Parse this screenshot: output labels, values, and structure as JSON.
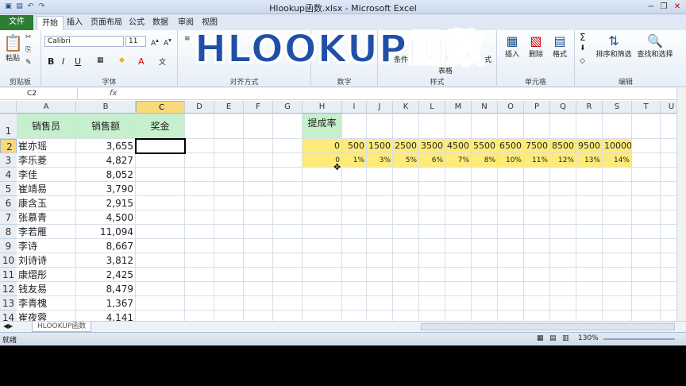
{
  "window": {
    "title": "Hlookup函数.xlsx - Microsoft Excel"
  },
  "overlay_title": "HLOOKUP函数",
  "tabs": [
    "文件",
    "开始",
    "插入",
    "页面布局",
    "公式",
    "数据",
    "审阅",
    "视图"
  ],
  "ribbon": {
    "paste": "粘贴",
    "clipboard": "剪贴板",
    "font_name": "Calibri",
    "font_size": "11",
    "font": "字体",
    "alignment": "对齐方式",
    "number": "数字",
    "style_partial_1": "条件",
    "style_partial_2": "表格",
    "style_partial_3": "式",
    "styles": "样式",
    "insert": "插入",
    "delete": "删除",
    "format": "格式",
    "cells": "单元格",
    "sort_filter": "排序和筛选",
    "find_select": "查找和选择",
    "editing": "编辑"
  },
  "namebox": "C2",
  "fx": "fx",
  "columns": [
    "A",
    "B",
    "C",
    "D",
    "E",
    "F",
    "G",
    "H",
    "I",
    "J",
    "K",
    "L",
    "M",
    "N",
    "O",
    "P",
    "Q",
    "R",
    "S",
    "T",
    "U"
  ],
  "rows": [
    "1",
    "2",
    "3",
    "4",
    "5",
    "6",
    "7",
    "8",
    "9",
    "10",
    "11",
    "12",
    "13",
    "14"
  ],
  "table": {
    "headers": [
      "销售员",
      "销售额",
      "奖金"
    ],
    "data": [
      [
        "崔亦瑶",
        "3,655"
      ],
      [
        "李乐菱",
        "4,827"
      ],
      [
        "李佳",
        "8,052"
      ],
      [
        "崔靖易",
        "3,790"
      ],
      [
        "康含玉",
        "2,915"
      ],
      [
        "张慕青",
        "4,500"
      ],
      [
        "李若雁",
        "11,094"
      ],
      [
        "李诗",
        "8,667"
      ],
      [
        "刘诗诗",
        "3,812"
      ],
      [
        "康熠彤",
        "2,425"
      ],
      [
        "钱友易",
        "8,479"
      ],
      [
        "李青槐",
        "1,367"
      ],
      [
        "崔夜蓉",
        "4,141"
      ]
    ]
  },
  "rate_table": {
    "label": "提成率",
    "tiers": [
      "0",
      "500",
      "1500",
      "2500",
      "3500",
      "4500",
      "5500",
      "6500",
      "7500",
      "8500",
      "9500",
      "10000"
    ],
    "rates": [
      "0",
      "1%",
      "3%",
      "5%",
      "6%",
      "7%",
      "8%",
      "10%",
      "11%",
      "12%",
      "13%",
      "14%"
    ]
  },
  "sheet_tab": "HLOOKUP函数",
  "status": {
    "ready": "就绪",
    "zoom": "130%"
  },
  "colors": {
    "header_green": "#c6efce",
    "rate_yellow": "#ffeb7a",
    "overlay_blue": "#1f4fa8",
    "file_tab": "#2e7d32"
  }
}
